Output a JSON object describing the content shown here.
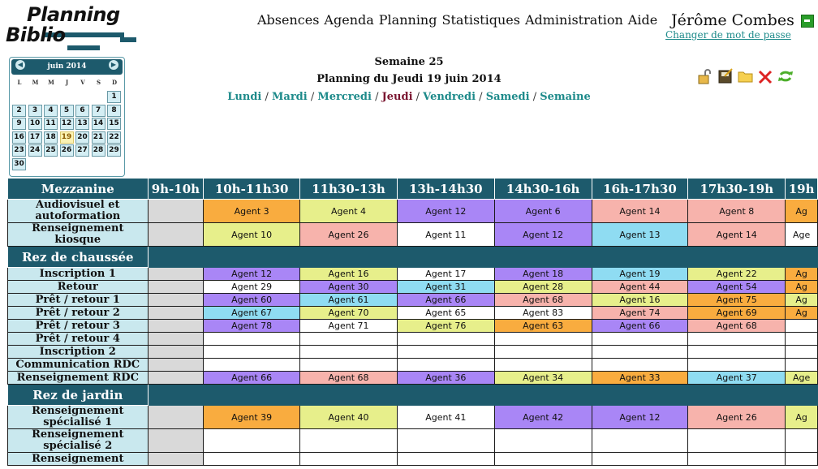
{
  "logo": {
    "line1": "Planning",
    "line2": "Biblio"
  },
  "menu": [
    "Absences",
    "Agenda",
    "Planning",
    "Statistiques",
    "Administration",
    "Aide"
  ],
  "user": {
    "name": "Jérôme Combes",
    "change_password": "Changer de mot de passe"
  },
  "calendar": {
    "month": "juin 2014",
    "prev": "◀",
    "next": "▶",
    "weekdays": [
      "L",
      "M",
      "M",
      "J",
      "V",
      "S",
      "D"
    ],
    "first_weekday_index": 6,
    "days_in_month": 30,
    "selected_day": 19
  },
  "header": {
    "week": "Semaine 25",
    "title": "Planning du Jeudi 19 juin 2014",
    "days": [
      "Lundi",
      "Mardi",
      "Mercredi",
      "Jeudi",
      "Vendredi",
      "Samedi",
      "Semaine"
    ],
    "current_day_index": 3
  },
  "colors": {
    "header_bg": "#1d5a6c",
    "post_bg": "#c9e8ee",
    "orange": "#f9ac3f",
    "yellow": "#e7ef8b",
    "purple": "#a986f6",
    "pink": "#f7b3ac",
    "blue": "#8fdcf2",
    "white": "#ffffff",
    "gray": "#d9d9d9"
  },
  "table": {
    "slots": [
      "9h-10h",
      "10h-11h30",
      "11h30-13h",
      "13h-14h30",
      "14h30-16h",
      "16h-17h30",
      "17h30-19h",
      "19h"
    ],
    "sections": [
      {
        "name": "Mezzanine",
        "rows": [
          {
            "post": "Audiovisuel et autoformation",
            "cells": [
              [
                "Agent 3",
                "orange"
              ],
              [
                "Agent 4",
                "yellow"
              ],
              [
                "Agent 12",
                "purple"
              ],
              [
                "Agent 6",
                "purple"
              ],
              [
                "Agent 14",
                "pink"
              ],
              [
                "Agent 8",
                "pink"
              ],
              [
                "Ag",
                "orange"
              ]
            ]
          },
          {
            "post": "Renseignement kiosque",
            "cells": [
              [
                "Agent 10",
                "yellow"
              ],
              [
                "Agent 26",
                "pink"
              ],
              [
                "Agent 11",
                "white"
              ],
              [
                "Agent 12",
                "purple"
              ],
              [
                "Agent 13",
                "blue"
              ],
              [
                "Agent 14",
                "pink"
              ],
              [
                "Age",
                "white"
              ]
            ]
          }
        ]
      },
      {
        "name": "Rez de chaussée",
        "rows": [
          {
            "post": "Inscription 1",
            "cells": [
              [
                "Agent 12",
                "purple"
              ],
              [
                "Agent 16",
                "yellow"
              ],
              [
                "Agent 17",
                "white"
              ],
              [
                "Agent 18",
                "purple"
              ],
              [
                "Agent 19",
                "blue"
              ],
              [
                "Agent 22",
                "yellow"
              ],
              [
                "Ag",
                "orange"
              ]
            ]
          },
          {
            "post": "Retour",
            "cells": [
              [
                "Agent 29",
                "white"
              ],
              [
                "Agent 30",
                "purple"
              ],
              [
                "Agent 31",
                "blue"
              ],
              [
                "Agent 28",
                "yellow"
              ],
              [
                "Agent 44",
                "pink"
              ],
              [
                "Agent 54",
                "purple"
              ],
              [
                "Ag",
                "orange"
              ]
            ]
          },
          {
            "post": "Prêt / retour 1",
            "cells": [
              [
                "Agent 60",
                "purple"
              ],
              [
                "Agent 61",
                "blue"
              ],
              [
                "Agent 66",
                "purple"
              ],
              [
                "Agent 68",
                "pink"
              ],
              [
                "Agent 16",
                "yellow"
              ],
              [
                "Agent 75",
                "orange"
              ],
              [
                "Ag",
                "yellow"
              ]
            ]
          },
          {
            "post": "Prêt / retour 2",
            "cells": [
              [
                "Agent 67",
                "blue"
              ],
              [
                "Agent 70",
                "yellow"
              ],
              [
                "Agent 65",
                "white"
              ],
              [
                "Agent 83",
                "white"
              ],
              [
                "Agent 74",
                "pink"
              ],
              [
                "Agent 69",
                "orange"
              ],
              [
                "Ag",
                "orange"
              ]
            ]
          },
          {
            "post": "Prêt / retour 3",
            "cells": [
              [
                "Agent 78",
                "purple"
              ],
              [
                "Agent 71",
                "white"
              ],
              [
                "Agent 76",
                "yellow"
              ],
              [
                "Agent 63",
                "orange"
              ],
              [
                "Agent 66",
                "purple"
              ],
              [
                "Agent 68",
                "pink"
              ],
              [
                "",
                "white"
              ]
            ]
          },
          {
            "post": "Prêt / retour 4",
            "cells": [
              [
                "",
                "white"
              ],
              [
                "",
                "white"
              ],
              [
                "",
                "white"
              ],
              [
                "",
                "white"
              ],
              [
                "",
                "white"
              ],
              [
                "",
                "white"
              ],
              [
                "",
                "white"
              ]
            ]
          },
          {
            "post": "Inscription 2",
            "cells": [
              [
                "",
                "white"
              ],
              [
                "",
                "white"
              ],
              [
                "",
                "white"
              ],
              [
                "",
                "white"
              ],
              [
                "",
                "white"
              ],
              [
                "",
                "white"
              ],
              [
                "",
                "white"
              ]
            ]
          },
          {
            "post": "Communication RDC",
            "cells": [
              [
                "",
                "white"
              ],
              [
                "",
                "white"
              ],
              [
                "",
                "white"
              ],
              [
                "",
                "white"
              ],
              [
                "",
                "white"
              ],
              [
                "",
                "white"
              ],
              [
                "",
                "white"
              ]
            ]
          },
          {
            "post": "Renseignement RDC",
            "cells": [
              [
                "Agent 66",
                "purple"
              ],
              [
                "Agent 68",
                "pink"
              ],
              [
                "Agent 36",
                "purple"
              ],
              [
                "Agent 34",
                "yellow"
              ],
              [
                "Agent 33",
                "orange"
              ],
              [
                "Agent 37",
                "blue"
              ],
              [
                "Age",
                "yellow"
              ]
            ]
          }
        ]
      },
      {
        "name": "Rez de jardin",
        "rows": [
          {
            "post": "Renseignement spécialisé 1",
            "cells": [
              [
                "Agent 39",
                "orange"
              ],
              [
                "Agent 40",
                "yellow"
              ],
              [
                "Agent 41",
                "white"
              ],
              [
                "Agent 42",
                "purple"
              ],
              [
                "Agent 12",
                "purple"
              ],
              [
                "Agent 26",
                "pink"
              ],
              [
                "Ag",
                "yellow"
              ]
            ]
          },
          {
            "post": "Renseignement spécialisé 2",
            "cells": [
              [
                "",
                "white"
              ],
              [
                "",
                "white"
              ],
              [
                "",
                "white"
              ],
              [
                "",
                "white"
              ],
              [
                "",
                "white"
              ],
              [
                "",
                "white"
              ],
              [
                "",
                "white"
              ]
            ]
          },
          {
            "post": "Renseignement",
            "cells": [
              [
                "",
                "white"
              ],
              [
                "",
                "white"
              ],
              [
                "",
                "white"
              ],
              [
                "",
                "white"
              ],
              [
                "",
                "white"
              ],
              [
                "",
                "white"
              ],
              [
                "",
                "white"
              ]
            ]
          }
        ]
      }
    ]
  }
}
